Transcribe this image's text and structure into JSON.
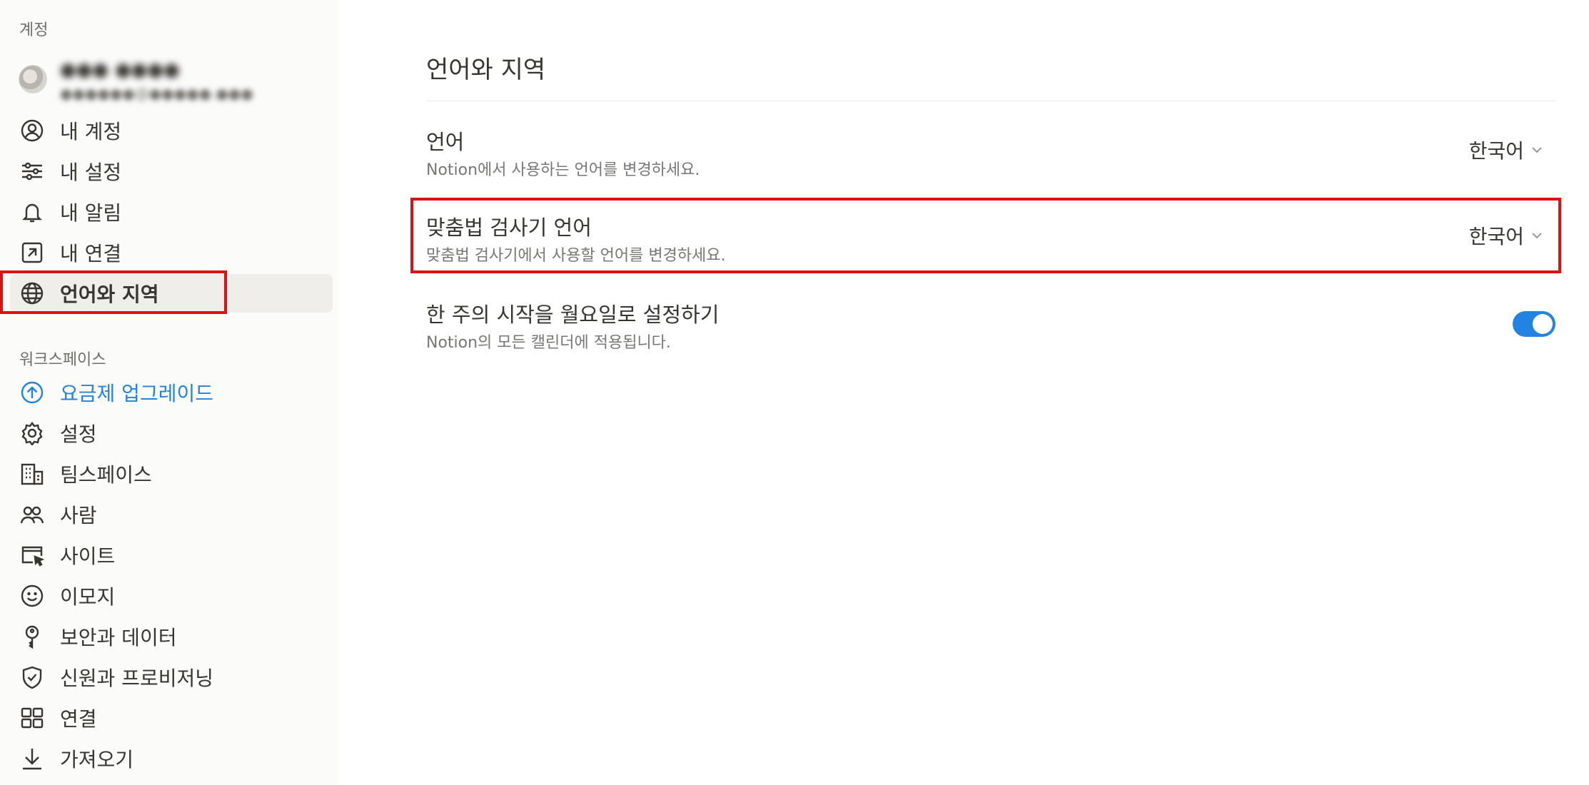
{
  "sidebar": {
    "account_label": "계정",
    "account": {
      "name": "●●● ●●●●",
      "email": "●●●●●●@●●●●●.●●●"
    },
    "account_items": [
      {
        "label": "내 계정",
        "icon": "user-circle-icon"
      },
      {
        "label": "내 설정",
        "icon": "sliders-icon"
      },
      {
        "label": "내 알림",
        "icon": "bell-icon"
      },
      {
        "label": "내 연결",
        "icon": "arrow-up-right-box-icon"
      },
      {
        "label": "언어와 지역",
        "icon": "globe-icon",
        "active": true
      }
    ],
    "workspace_label": "워크스페이스",
    "workspace_items": [
      {
        "label": "요금제 업그레이드",
        "icon": "arrow-up-circle-icon"
      },
      {
        "label": "설정",
        "icon": "gear-icon"
      },
      {
        "label": "팀스페이스",
        "icon": "building-icon"
      },
      {
        "label": "사람",
        "icon": "people-icon"
      },
      {
        "label": "사이트",
        "icon": "browser-cursor-icon"
      },
      {
        "label": "이모지",
        "icon": "smiley-icon"
      },
      {
        "label": "보안과 데이터",
        "icon": "key-icon"
      },
      {
        "label": "신원과 프로비저닝",
        "icon": "shield-check-icon"
      },
      {
        "label": "연결",
        "icon": "grid-icon"
      },
      {
        "label": "가져오기",
        "icon": "download-icon"
      }
    ]
  },
  "main": {
    "title": "언어와 지역",
    "settings": [
      {
        "title": "언어",
        "description": "Notion에서 사용하는 언어를 변경하세요.",
        "value": "한국어"
      },
      {
        "title": "맞춤법 검사기 언어",
        "description": "맞춤법 검사기에서 사용할 언어를 변경하세요.",
        "value": "한국어"
      },
      {
        "title": "한 주의 시작을 월요일로 설정하기",
        "description": "Notion의 모든 캘린더에 적용됩니다.",
        "toggle_on": true
      }
    ]
  },
  "colors": {
    "accent": "#2383e2",
    "highlight": "#e01010",
    "sidebar_bg": "#fbfbfa",
    "active_bg": "#efeeeb"
  }
}
